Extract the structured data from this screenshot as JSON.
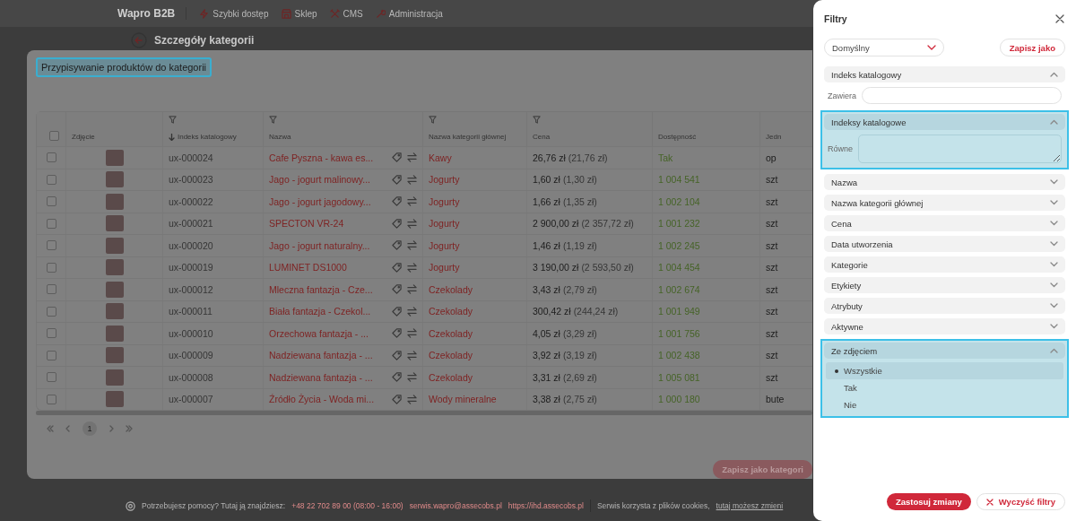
{
  "topbar": {
    "brand": "Wapro B2B",
    "nav": [
      {
        "kind": "bolt",
        "label": "Szybki dostęp"
      },
      {
        "kind": "shop",
        "label": "Sklep"
      },
      {
        "kind": "tools",
        "label": "CMS"
      },
      {
        "kind": "wrench",
        "label": "Administracja"
      }
    ]
  },
  "page_header": {
    "title": "Szczegóły kategorii"
  },
  "modal": {
    "title": "Przypisywanie produktów do kategorii",
    "highlighted": true,
    "table": {
      "select_all_checked": false,
      "columns": [
        {
          "label": "Zdjęcie",
          "filter": false,
          "sorted": false
        },
        {
          "label": "Indeks katalogowy",
          "filter": true,
          "sorted": true
        },
        {
          "label": "Nazwa",
          "filter": true,
          "sorted": false
        },
        {
          "label": "Nazwa kategorii głównej",
          "filter": true,
          "sorted": false
        },
        {
          "label": "Cena",
          "filter": true,
          "sorted": false
        },
        {
          "label": "Dostępność",
          "filter": false,
          "sorted": false
        },
        {
          "label": "Jedn",
          "filter": false,
          "sorted": false
        }
      ],
      "rows": [
        {
          "checked": false,
          "index": "ux-000024",
          "name": "Cafe Pyszna - kawa es...",
          "category": "Kawy",
          "price": "26,76 zł",
          "price_net": "(21,76 zł)",
          "availability": "Tak",
          "unit": "op"
        },
        {
          "checked": false,
          "index": "ux-000023",
          "name": "Jago - jogurt malinowy...",
          "category": "Jogurty",
          "price": "1,60 zł",
          "price_net": "(1,30 zł)",
          "availability": "1 004 541",
          "unit": "szt"
        },
        {
          "checked": false,
          "index": "ux-000022",
          "name": "Jago - jogurt jagodowy...",
          "category": "Jogurty",
          "price": "1,66 zł",
          "price_net": "(1,35 zł)",
          "availability": "1 002 104",
          "unit": "szt"
        },
        {
          "checked": false,
          "index": "ux-000021",
          "name": "SPECTON VR-24",
          "category": "Jogurty",
          "price": "2 900,00 zł",
          "price_net": "(2 357,72 zł)",
          "availability": "1 001 232",
          "unit": "szt"
        },
        {
          "checked": false,
          "index": "ux-000020",
          "name": "Jago - jogurt naturalny...",
          "category": "Jogurty",
          "price": "1,46 zł",
          "price_net": "(1,19 zł)",
          "availability": "1 002 245",
          "unit": "szt"
        },
        {
          "checked": false,
          "index": "ux-000019",
          "name": "LUMINET DS1000",
          "category": "Jogurty",
          "price": "3 190,00 zł",
          "price_net": "(2 593,50 zł)",
          "availability": "1 004 454",
          "unit": "szt"
        },
        {
          "checked": false,
          "index": "ux-000012",
          "name": "Mleczna fantazja - Cze...",
          "category": "Czekolady",
          "price": "3,43 zł",
          "price_net": "(2,79 zł)",
          "availability": "1 002 674",
          "unit": "szt"
        },
        {
          "checked": false,
          "index": "ux-000011",
          "name": "Biała fantazja - Czekol...",
          "category": "Czekolady",
          "price": "300,42 zł",
          "price_net": "(244,24 zł)",
          "availability": "1 001 949",
          "unit": "szt"
        },
        {
          "checked": false,
          "index": "ux-000010",
          "name": "Orzechowa fantazja - ...",
          "category": "Czekolady",
          "price": "4,05 zł",
          "price_net": "(3,29 zł)",
          "availability": "1 001 756",
          "unit": "szt"
        },
        {
          "checked": false,
          "index": "ux-000009",
          "name": "Nadziewana fantazja - ...",
          "category": "Czekolady",
          "price": "3,92 zł",
          "price_net": "(3,19 zł)",
          "availability": "1 002 438",
          "unit": "szt"
        },
        {
          "checked": false,
          "index": "ux-000008",
          "name": "Nadziewana fantazja - ...",
          "category": "Czekolady",
          "price": "3,31 zł",
          "price_net": "(2,69 zł)",
          "availability": "1 005 081",
          "unit": "szt"
        },
        {
          "checked": false,
          "index": "ux-000007",
          "name": "Źródło Życia - Woda mi...",
          "category": "Wody mineralne",
          "price": "3,38 zł",
          "price_net": "(2,75 zł)",
          "availability": "1 000 180",
          "unit": "bute"
        }
      ]
    },
    "pagination": {
      "pages": [
        {
          "label": "1",
          "selected": true
        }
      ]
    },
    "save_button": "Zapisz jako kategori"
  },
  "footer": {
    "help_text": "Potrzebujesz pomocy? Tutaj ją znajdziesz:",
    "phone": "+48 22 702 89 00 (08:00 - 16:00)",
    "email": "serwis.wapro@assecobs.pl",
    "url": "https://ihd.assecobs.pl",
    "cookies_text": "Serwis korzysta z plików cookies,",
    "cookies_link": "tutaj możesz zmieni"
  },
  "drawer": {
    "title": "Filtry",
    "preset": {
      "value": "Domyślny"
    },
    "save_as_button": "Zapisz jako",
    "sections": [
      {
        "label": "Indeks katalogowy",
        "expanded": true,
        "highlighted": false,
        "kind": "text",
        "field_label": "Zawiera"
      },
      {
        "label": "Indeksy katalogowe",
        "expanded": true,
        "highlighted": true,
        "kind": "textarea",
        "field_label": "Równe"
      },
      {
        "label": "Nazwa",
        "expanded": false,
        "highlighted": false
      },
      {
        "label": "Nazwa kategorii głównej",
        "expanded": false,
        "highlighted": false
      },
      {
        "label": "Cena",
        "expanded": false,
        "highlighted": false
      },
      {
        "label": "Data utworzenia",
        "expanded": false,
        "highlighted": false
      },
      {
        "label": "Kategorie",
        "expanded": false,
        "highlighted": false
      },
      {
        "label": "Etykiety",
        "expanded": false,
        "highlighted": false
      },
      {
        "label": "Atrybuty",
        "expanded": false,
        "highlighted": false
      },
      {
        "label": "Aktywne",
        "expanded": false,
        "highlighted": false
      },
      {
        "label": "Ze zdjęciem",
        "expanded": true,
        "highlighted": true,
        "kind": "radio",
        "options": [
          {
            "label": "Wszystkie",
            "selected": true
          },
          {
            "label": "Tak",
            "selected": false
          },
          {
            "label": "Nie",
            "selected": false
          }
        ]
      }
    ],
    "apply_button": "Zastosuj zmiany",
    "clear_button": "Wyczyść filtry"
  }
}
